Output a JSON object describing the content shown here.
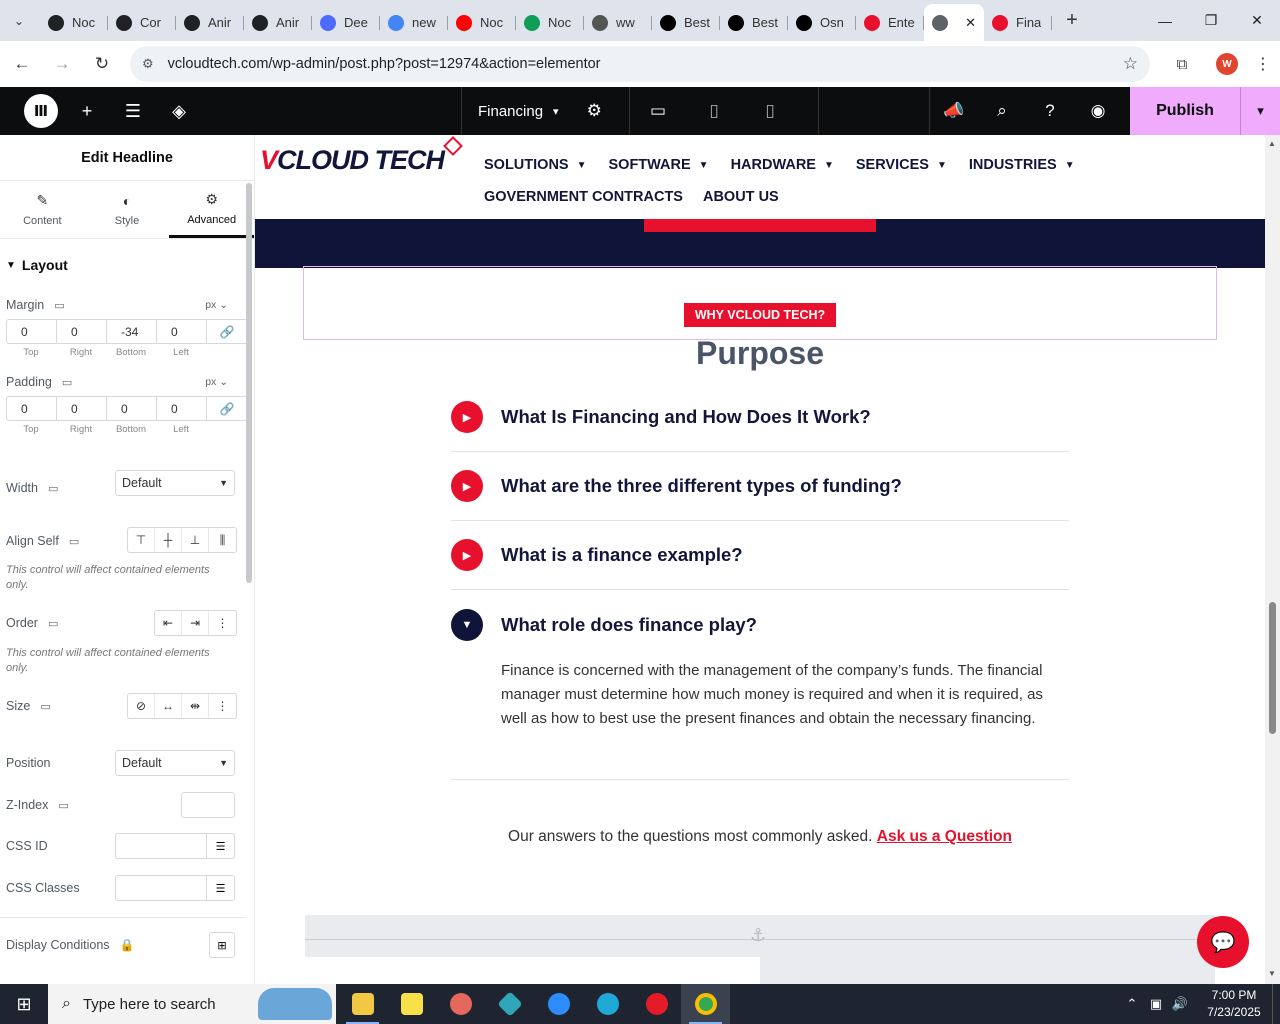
{
  "browser": {
    "tabs": [
      {
        "title": "Noc",
        "icon": "openai-icon",
        "color": "#202124"
      },
      {
        "title": "Cor",
        "icon": "openai-icon",
        "color": "#202124"
      },
      {
        "title": "Anir",
        "icon": "openai-icon",
        "color": "#202124"
      },
      {
        "title": "Anir",
        "icon": "openai-icon",
        "color": "#202124"
      },
      {
        "title": "Dee",
        "icon": "deepseek-icon",
        "color": "#4d6bfe"
      },
      {
        "title": "new",
        "icon": "google-icon",
        "color": "#4285f4"
      },
      {
        "title": "Noc",
        "icon": "youtube-icon",
        "color": "#ff0000"
      },
      {
        "title": "Noc",
        "icon": "webflow-icon",
        "color": "#0f9d58"
      },
      {
        "title": "ww",
        "icon": "linkedin-icon",
        "color": "#555555"
      },
      {
        "title": "Best",
        "icon": "x-icon",
        "color": "#000000"
      },
      {
        "title": "Best",
        "icon": "x-icon",
        "color": "#000000"
      },
      {
        "title": "Osn",
        "icon": "perplexity-icon",
        "color": "#000000"
      },
      {
        "title": "Ente",
        "icon": "elementor-red-icon",
        "color": "#e8112d"
      },
      {
        "title": "",
        "icon": "globe-icon",
        "color": "#5f6368",
        "active": true
      },
      {
        "title": "Fina",
        "icon": "elementor-red-icon",
        "color": "#e8112d"
      }
    ],
    "url": "vcloudtech.com/wp-admin/post.php?post=12974&action=elementor",
    "profile_initial": "W"
  },
  "editor": {
    "page_name": "Financing",
    "publish_label": "Publish"
  },
  "panel": {
    "title": "Edit Headline",
    "tabs": [
      {
        "label": "Content",
        "icon": "pencil-icon"
      },
      {
        "label": "Style",
        "icon": "contrast-icon"
      },
      {
        "label": "Advanced",
        "icon": "gear-icon",
        "active": true
      }
    ],
    "section": "Layout",
    "margin": {
      "label": "Margin",
      "unit": "px",
      "top": "0",
      "right": "0",
      "bottom": "-34",
      "left": "0"
    },
    "padding": {
      "label": "Padding",
      "unit": "px",
      "top": "0",
      "right": "0",
      "bottom": "0",
      "left": "0"
    },
    "side_labels": {
      "top": "Top",
      "right": "Right",
      "bottom": "Bottom",
      "left": "Left"
    },
    "width": {
      "label": "Width",
      "value": "Default"
    },
    "align_self": {
      "label": "Align Self"
    },
    "note": "This control will affect contained elements only.",
    "order": {
      "label": "Order"
    },
    "size": {
      "label": "Size"
    },
    "position": {
      "label": "Position",
      "value": "Default"
    },
    "zindex": {
      "label": "Z-Index"
    },
    "css_id": {
      "label": "CSS ID"
    },
    "css_classes": {
      "label": "CSS Classes"
    },
    "display_conditions": {
      "label": "Display Conditions"
    }
  },
  "site": {
    "logo_v": "V",
    "logo_rest": "CLOUD TECH",
    "menu_row1": [
      "SOLUTIONS",
      "SOFTWARE",
      "HARDWARE",
      "SERVICES",
      "INDUSTRIES"
    ],
    "menu_row2": [
      "GOVERNMENT CONTRACTS",
      "ABOUT US"
    ],
    "badge": "WHY VCLOUD TECH?",
    "heading": "Purpose",
    "faqs": [
      {
        "q": "What Is Financing and How Does It Work?",
        "open": false
      },
      {
        "q": "What are the three different types of funding?",
        "open": false
      },
      {
        "q": "What is a finance example?",
        "open": false
      },
      {
        "q": "What role does finance play?",
        "open": true
      }
    ],
    "answer": "Finance is concerned with the management of the company’s funds. The financial manager must determine how much money is required and when it is required, as well as how to best use the present finances and obtain the necessary financing.",
    "ask_text": "Our answers to the questions most commonly asked.",
    "ask_link": "Ask us a Question"
  },
  "taskbar": {
    "search_placeholder": "Type here to search",
    "time": "7:00 PM",
    "date": "7/23/2025"
  }
}
